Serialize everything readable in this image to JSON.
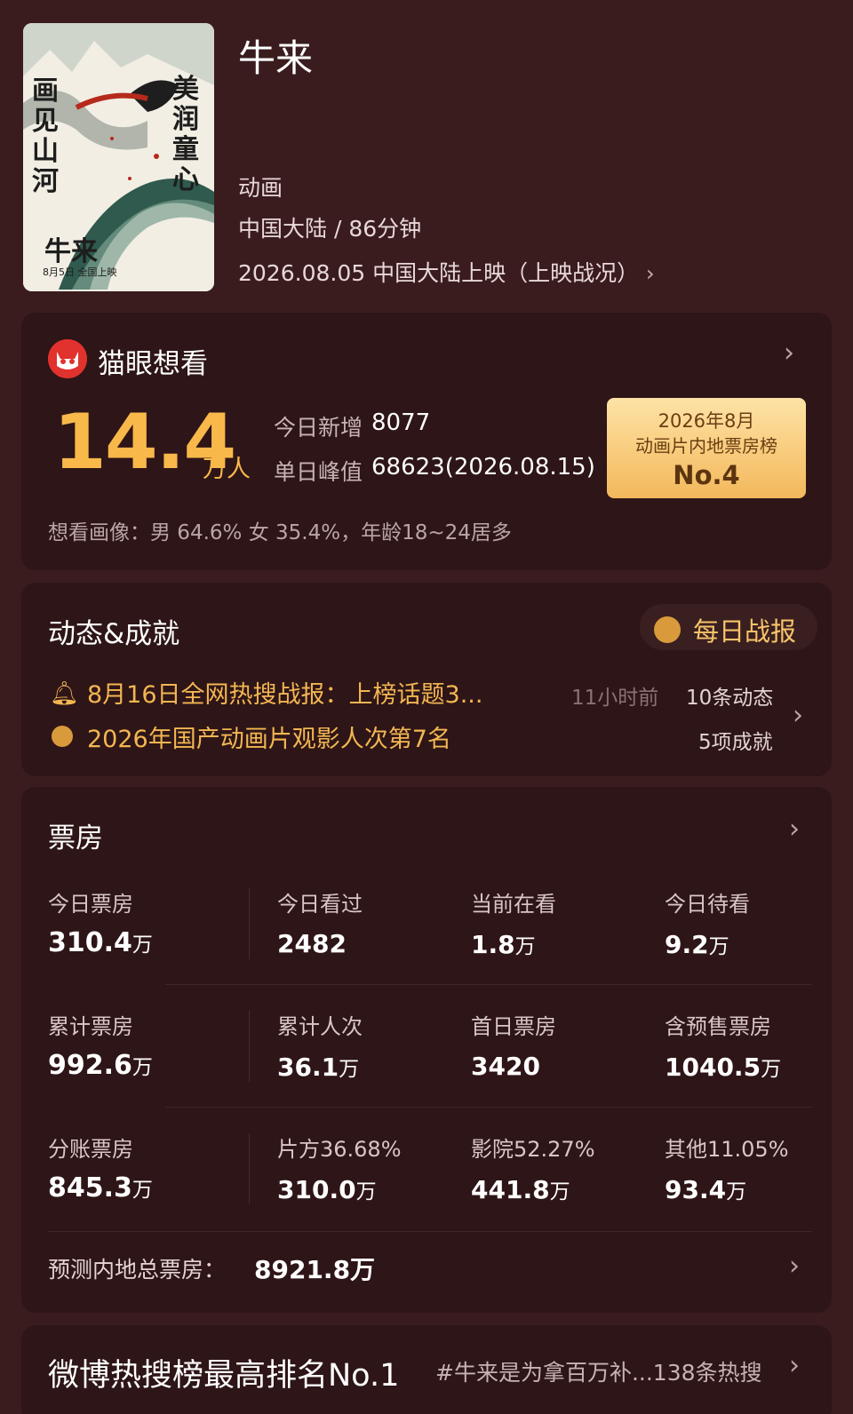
{
  "header": {
    "title": "牛来",
    "genre": "动画",
    "region_duration": "中国大陆 / 86分钟",
    "release": "2026.08.05 中国大陆上映（上映战况）"
  },
  "poster": {
    "text_left": "画见山河",
    "text_right": "美润童心",
    "text_title": "牛来",
    "text_date": "8月5日 全国上映"
  },
  "want": {
    "title": "猫眼想看",
    "big_number": "14.4",
    "big_unit": "万人",
    "today_new_label": "今日新增",
    "today_new_value": "8077",
    "peak_label": "单日峰值",
    "peak_value": "68623(2026.08.15)",
    "profile": "想看画像：男 64.6%  女 35.4%，年龄18~24居多",
    "rank": {
      "line1": "2026年8月",
      "line2": "动画片内地票房榜",
      "line3": "No.4"
    }
  },
  "news": {
    "title": "动态&成就",
    "daily_report": "每日战报",
    "item1": "8月16日全网热搜战报：上榜话题3...",
    "item1_time": "11小时前",
    "item1_count": "10条动态",
    "item2": "2026年国产动画片观影人次第7名",
    "item2_count": "5项成就"
  },
  "boxoffice": {
    "title": "票房",
    "rows": [
      [
        {
          "label": "今日票房",
          "value": "310.4",
          "unit": "万"
        },
        {
          "label": "今日看过",
          "value": "2482",
          "unit": ""
        },
        {
          "label": "当前在看",
          "value": "1.8",
          "unit": "万"
        },
        {
          "label": "今日待看",
          "value": "9.2",
          "unit": "万"
        }
      ],
      [
        {
          "label": "累计票房",
          "value": "992.6",
          "unit": "万"
        },
        {
          "label": "累计人次",
          "value": "36.1",
          "unit": "万"
        },
        {
          "label": "首日票房",
          "value": "3420",
          "unit": ""
        },
        {
          "label": "含预售票房",
          "value": "1040.5",
          "unit": "万"
        }
      ],
      [
        {
          "label": "分账票房",
          "value": "845.3",
          "unit": "万"
        },
        {
          "label": "片方36.68%",
          "value": "310.0",
          "unit": "万"
        },
        {
          "label": "影院52.27%",
          "value": "441.8",
          "unit": "万"
        },
        {
          "label": "其他11.05%",
          "value": "93.4",
          "unit": "万"
        }
      ]
    ],
    "forecast_label": "预测内地总票房：",
    "forecast_value": "8921.8万"
  },
  "weibo": {
    "title": "微博热搜榜最高排名No.1",
    "tag": "#牛来是为拿百万补...138条热搜"
  },
  "colors": {
    "background": "#3a1c1e",
    "card": "#2e1517",
    "accent": "#f9b84a",
    "maoyan_red": "#e2322d"
  }
}
